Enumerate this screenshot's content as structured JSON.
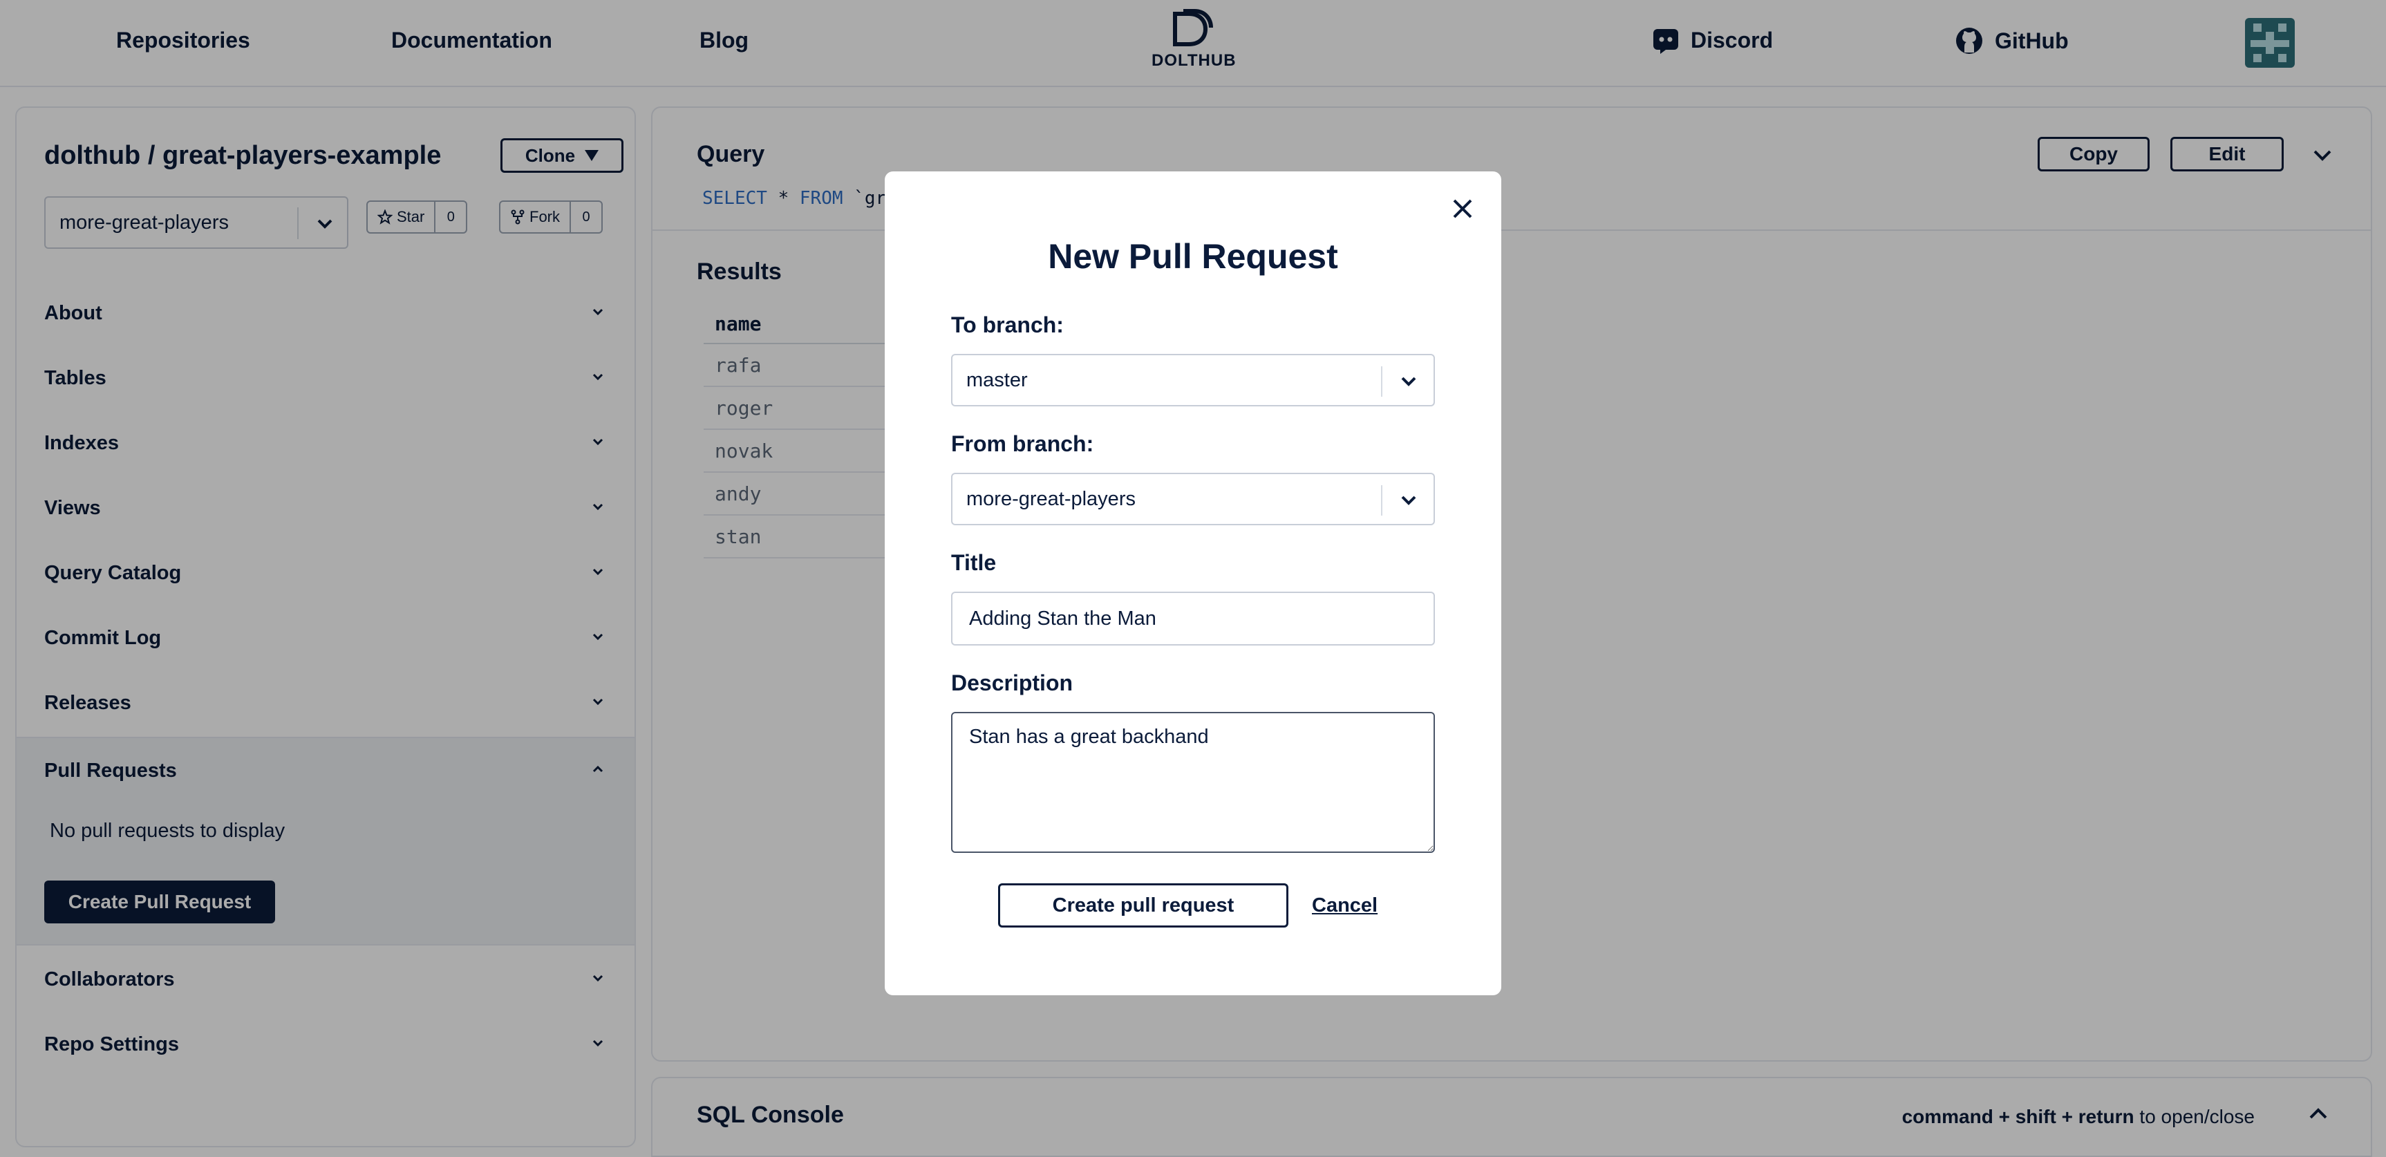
{
  "nav": {
    "repositories": "Repositories",
    "documentation": "Documentation",
    "blog": "Blog",
    "logo_text": "DOLTHUB",
    "discord": "Discord",
    "github": "GitHub"
  },
  "repo": {
    "title": "dolthub / great-players-example",
    "clone_label": "Clone",
    "branch": "more-great-players",
    "star_label": "Star",
    "star_count": "0",
    "fork_label": "Fork",
    "fork_count": "0"
  },
  "sidebar": {
    "sections": [
      {
        "label": "About"
      },
      {
        "label": "Tables"
      },
      {
        "label": "Indexes"
      },
      {
        "label": "Views"
      },
      {
        "label": "Query Catalog"
      },
      {
        "label": "Commit Log"
      },
      {
        "label": "Releases"
      },
      {
        "label": "Pull Requests"
      },
      {
        "label": "Collaborators"
      },
      {
        "label": "Repo Settings"
      }
    ],
    "pull_requests_empty": "No pull requests to display",
    "create_pull_request": "Create Pull Request"
  },
  "query": {
    "title": "Query",
    "sql_select": "SELECT",
    "sql_star": "*",
    "sql_from": "FROM",
    "sql_table_fragment": "`gr",
    "copy_label": "Copy",
    "edit_label": "Edit"
  },
  "results": {
    "title": "Results",
    "column": "name",
    "rows": [
      "rafa",
      "roger",
      "novak",
      "andy",
      "stan"
    ]
  },
  "console": {
    "title": "SQL Console",
    "shortcut": "command + shift + return",
    "hint": "to open/close"
  },
  "modal": {
    "title": "New Pull Request",
    "to_branch_label": "To branch:",
    "to_branch_value": "master",
    "from_branch_label": "From branch:",
    "from_branch_value": "more-great-players",
    "title_label": "Title",
    "title_value": "Adding Stan the Man",
    "description_label": "Description",
    "description_value": "Stan has a great backhand",
    "submit_label": "Create pull request",
    "cancel_label": "Cancel"
  }
}
